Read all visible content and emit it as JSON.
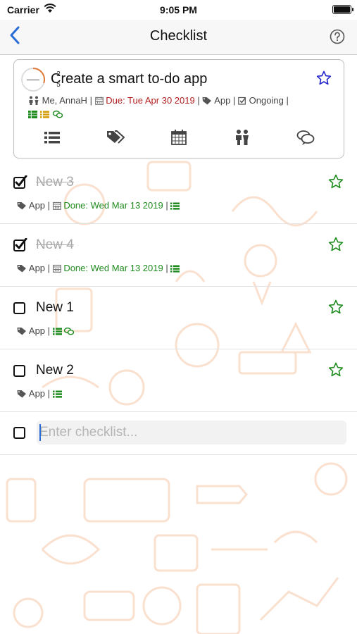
{
  "status_bar": {
    "carrier": "Carrier",
    "time": "9:05 PM"
  },
  "nav": {
    "title": "Checklist",
    "back_icon": "chevron-left-icon",
    "help_icon": "question-circle-icon"
  },
  "task": {
    "progress_done": "2",
    "progress_total": "5",
    "title": "Create a smart to-do app",
    "assignees": "Me, AnnaH",
    "due": "Due: Tue Apr 30 2019",
    "tag": "App",
    "status": "Ongoing",
    "separator": "|",
    "toolbar_icons": [
      "list-icon",
      "tags-icon",
      "calendar-icon",
      "people-icon",
      "comments-icon"
    ]
  },
  "checklist": [
    {
      "label": "New 3",
      "checked": true,
      "tag": "App",
      "done": "Done: Wed Mar 13 2019",
      "has_comments": false
    },
    {
      "label": "New 4",
      "checked": true,
      "tag": "App",
      "done": "Done: Wed Mar 13 2019",
      "has_comments": false
    },
    {
      "label": "New 1",
      "checked": false,
      "tag": "App",
      "done": "",
      "has_comments": true
    },
    {
      "label": "New 2",
      "checked": false,
      "tag": "App",
      "done": "",
      "has_comments": false
    }
  ],
  "new_item": {
    "placeholder": "Enter checklist..."
  },
  "colors": {
    "accent_blue": "#2a6cd6",
    "due_red": "#b21e1e",
    "done_green": "#1e8b1e",
    "star_blue": "#2222cc",
    "star_green": "#1e8b1e",
    "doodle": "#f6c7a9"
  }
}
